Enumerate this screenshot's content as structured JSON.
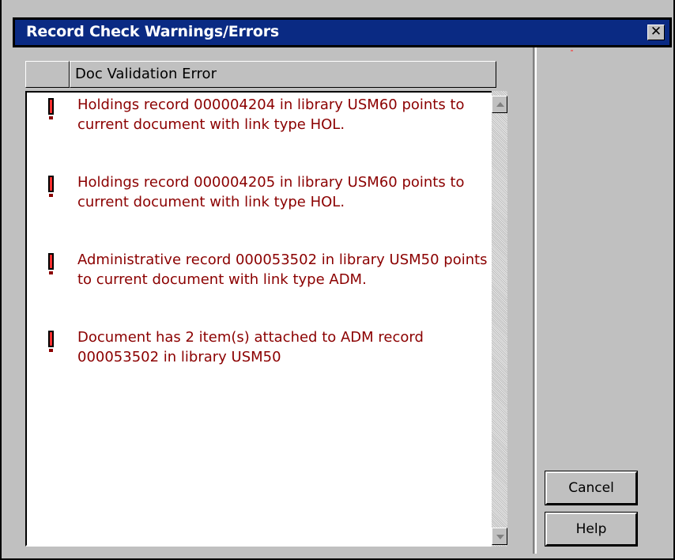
{
  "window": {
    "title": "Record Check Warnings/Errors",
    "close_glyph": "✕"
  },
  "list": {
    "column_header": "Doc Validation Error",
    "items": [
      {
        "icon": "exclamation-icon",
        "text": "Holdings record 000004204 in library USM60 points to current document with link type HOL."
      },
      {
        "icon": "exclamation-icon",
        "text": "Holdings record 000004205 in library USM60 points to current document with link type HOL."
      },
      {
        "icon": "exclamation-icon",
        "text": "Administrative record 000053502 in library USM50 points to current document with link type ADM."
      },
      {
        "icon": "exclamation-icon",
        "text": "Document has 2 item(s) attached to ADM record 000053502 in library USM50"
      }
    ]
  },
  "buttons": {
    "cancel": "Cancel",
    "help": "Help"
  },
  "colors": {
    "titlebar": "#0a2a83",
    "message_text": "#8b0000",
    "face": "#c0c0c0"
  }
}
